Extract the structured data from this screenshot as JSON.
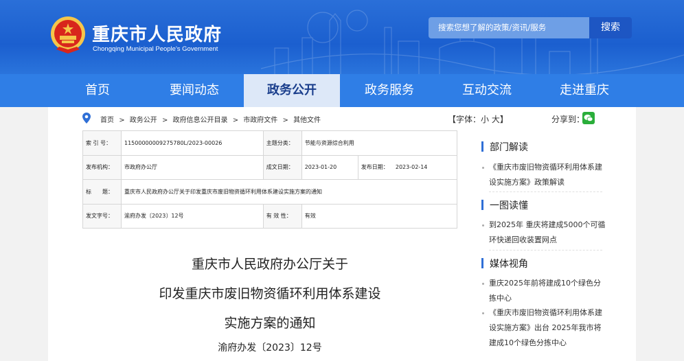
{
  "header": {
    "title": "重庆市人民政府",
    "subtitle": "Chongqing Municipal People's Government",
    "search_placeholder": "搜索您想了解的政策/资讯/服务",
    "search_button": "搜索"
  },
  "nav": [
    {
      "label": "首页"
    },
    {
      "label": "要闻动态"
    },
    {
      "label": "政务公开"
    },
    {
      "label": "政务服务"
    },
    {
      "label": "互动交流"
    },
    {
      "label": "走进重庆"
    }
  ],
  "breadcrumb": {
    "items": [
      "首页",
      "政务公开",
      "政府信息公开目录",
      "市政府文件",
      "其他文件"
    ],
    "sep": ">"
  },
  "tools": {
    "font_size": "【字体：小 大】",
    "share": "分享到："
  },
  "meta": {
    "index_label": "索 引 号：",
    "index_value": "11500000009275780L/2023-00026",
    "topic_label": "主题分类：",
    "topic_value": "节能与资源综合利用",
    "issuer_label": "发布机构：",
    "issuer_value": "市政府办公厅",
    "written_label": "成文日期：",
    "written_value": "2023-01-20",
    "published_label": "发布日期：",
    "published_value": "2023-02-14",
    "title_label": "标　　题：",
    "title_value": "重庆市人民政府办公厅关于印发重庆市废旧物资循环利用体系建设实施方案的通知",
    "docno_label": "发文字号：",
    "docno_value": "渝府办发〔2023〕12号",
    "valid_label": "有 效 性：",
    "valid_value": "有效"
  },
  "document": {
    "title_line1": "重庆市人民政府办公厅关于",
    "title_line2": "印发重庆市废旧物资循环利用体系建设",
    "title_line3": "实施方案的通知",
    "doc_number": "渝府办发〔2023〕12号"
  },
  "sidebar": {
    "sections": [
      {
        "heading": "部门解读",
        "items": [
          "《重庆市废旧物资循环利用体系建设实施方案》政策解读"
        ]
      },
      {
        "heading": "一图读懂",
        "items": [
          "到2025年 重庆将建成5000个可循环快递回收装置网点"
        ]
      },
      {
        "heading": "媒体视角",
        "items": [
          "重庆2025年前将建成10个绿色分拣中心",
          "《重庆市废旧物资循环利用体系建设实施方案》出台 2025年我市将建成10个绿色分拣中心"
        ]
      }
    ]
  },
  "colors": {
    "header_blue": "#1b5fcf",
    "nav_blue": "#2f7ee6",
    "nav_active_bg": "#dde8f8",
    "accent": "#2f6fd6",
    "emblem_red": "#d8261c",
    "emblem_gold": "#f5c64a"
  }
}
